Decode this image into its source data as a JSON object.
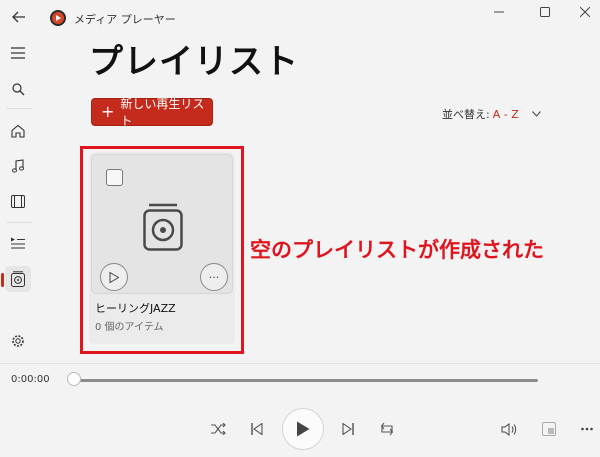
{
  "window": {
    "title": "メディア プレーヤー"
  },
  "sidebar": {
    "items": [
      {
        "name": "menu-icon"
      },
      {
        "name": "search-icon"
      },
      {
        "name": "home-icon"
      },
      {
        "name": "music-icon"
      },
      {
        "name": "video-icon"
      },
      {
        "name": "queue-icon"
      },
      {
        "name": "playlist-icon",
        "active": true
      },
      {
        "name": "settings-icon"
      }
    ]
  },
  "main": {
    "title": "プレイリスト",
    "new_button_plus": "+",
    "new_button_label": "新しい再生リスト",
    "sort_label": "並べ替え:",
    "sort_value": "A - Z"
  },
  "playlists": [
    {
      "title": "ヒーリングJAZZ",
      "subtitle": "0 個のアイテム"
    }
  ],
  "card_more_label": "···",
  "annotation": {
    "text": "空のプレイリストが作成された",
    "color": "#e0141e"
  },
  "player": {
    "time": "0:00:00",
    "progress": 0
  },
  "colors": {
    "accent": "#c42b1c"
  }
}
